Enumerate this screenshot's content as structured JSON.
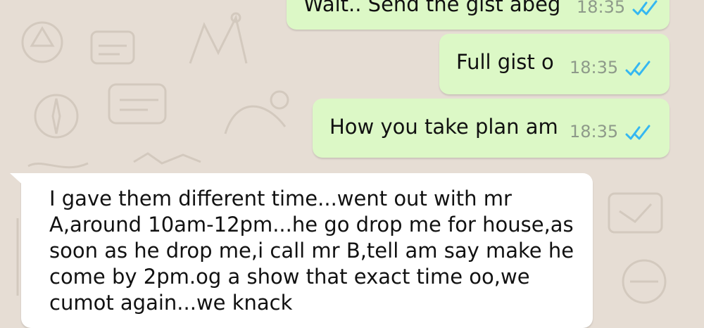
{
  "colors": {
    "outgoing_bubble": "#dcf8c6",
    "incoming_bubble": "#ffffff",
    "background": "#e6ddd4",
    "read_ticks": "#34b7f1",
    "timestamp": "#8e9a8a"
  },
  "messages": [
    {
      "direction": "outgoing",
      "text": "Wait.. Send the gist abeg",
      "time": "18:35",
      "status_icon": "double-check-read-icon"
    },
    {
      "direction": "outgoing",
      "text": "Full gist o",
      "time": "18:35",
      "status_icon": "double-check-read-icon"
    },
    {
      "direction": "outgoing",
      "text": "How you take plan am",
      "time": "18:35",
      "status_icon": "double-check-read-icon"
    },
    {
      "direction": "incoming",
      "text": "I gave them different time...went out with mr A,around 10am-12pm...he go drop me for house,as soon as he drop me,i call mr B,tell am say make he come by 2pm.og a show that exact time oo,we cumot again...we knack"
    }
  ]
}
